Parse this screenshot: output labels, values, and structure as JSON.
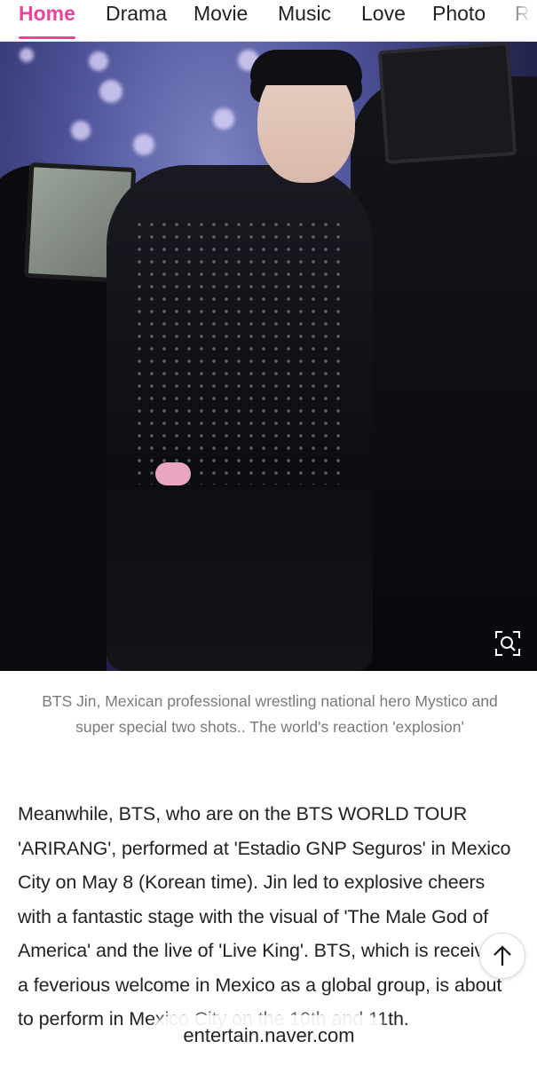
{
  "nav": {
    "items": [
      {
        "label": "Home",
        "active": true
      },
      {
        "label": "Drama",
        "active": false
      },
      {
        "label": "Movie",
        "active": false
      },
      {
        "label": "Music",
        "active": false
      },
      {
        "label": "Love",
        "active": false
      },
      {
        "label": "Photo",
        "active": false
      },
      {
        "label": "Ra",
        "active": false
      }
    ],
    "accent_color": "#e8459a"
  },
  "photo": {
    "zoom_icon": "zoom-magnifier-icon"
  },
  "caption": "BTS Jin, Mexican professional wrestling national hero Mystico and super special two shots.. The world's reaction 'explosion'",
  "article": {
    "paragraph": "Meanwhile, BTS, who are on the BTS WORLD TOUR 'ARIRANG', performed at 'Estadio GNP Seguros' in Mexico City on May 8 (Korean time). Jin led to explosive cheers with a fantastic stage with the visual of 'The Male God of America' and the live of 'Live King'. BTS, which is receiving a feverious welcome in Mexico as a global group, is about to perform in Mexico City on the 10th and 11th."
  },
  "scroll_top": {
    "icon": "arrow-up-icon"
  },
  "domain": "entertain.naver.com"
}
